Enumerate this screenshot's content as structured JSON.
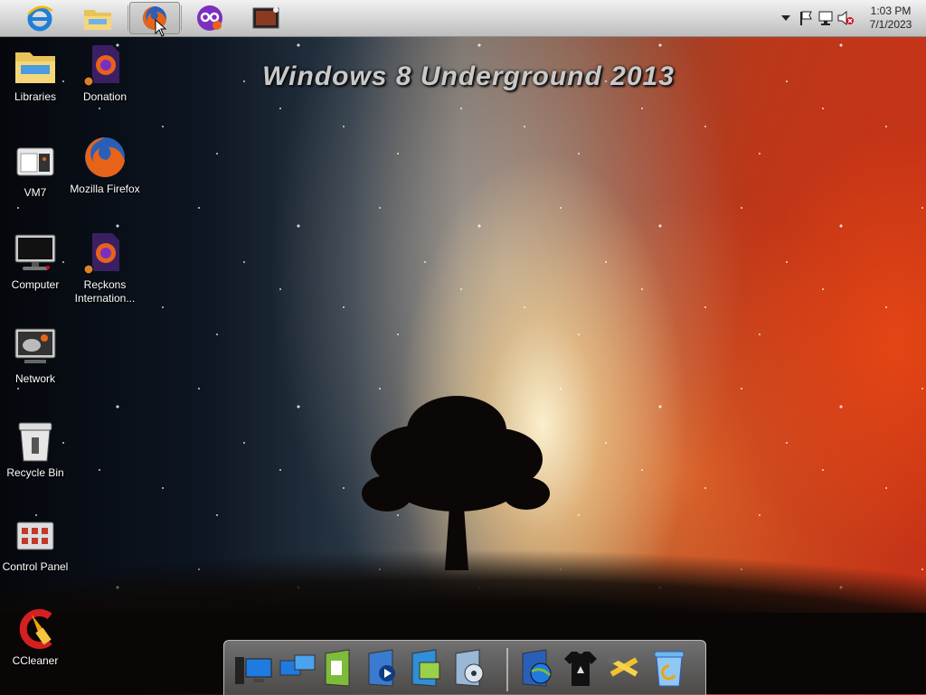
{
  "wallpaper": {
    "brand_text": "Windows 8 Underground 2013"
  },
  "taskbar": {
    "pinned": [
      {
        "name": "internet-explorer",
        "icon": "ie-icon"
      },
      {
        "name": "file-explorer",
        "icon": "folder-icon"
      },
      {
        "name": "firefox",
        "icon": "firefox-icon",
        "active": true
      },
      {
        "name": "purple-app",
        "icon": "purple-app-icon"
      },
      {
        "name": "media-player",
        "icon": "media-icon"
      }
    ],
    "tray": {
      "icons": [
        "arrow-up-icon",
        "flag-icon",
        "network-icon",
        "volume-muted-icon"
      ],
      "time": "1:03 PM",
      "date": "7/1/2023"
    }
  },
  "desktop": {
    "icons": [
      {
        "label": "Libraries",
        "icon": "libraries-icon"
      },
      {
        "label": "Donation",
        "icon": "firefox-doc-icon"
      },
      {
        "label": "VM7",
        "icon": "vm-icon"
      },
      {
        "label": "Mozilla Firefox",
        "icon": "firefox-icon"
      },
      {
        "label": "Computer",
        "icon": "computer-icon"
      },
      {
        "label": "Reckons Internation...",
        "icon": "firefox-doc-icon"
      },
      {
        "label": "Network",
        "icon": "network-icon"
      },
      {
        "label": "Recycle Bin",
        "icon": "recycle-bin-icon"
      },
      {
        "label": "Control Panel",
        "icon": "control-panel-icon"
      },
      {
        "label": "CCleaner",
        "icon": "ccleaner-icon"
      }
    ]
  },
  "dock": {
    "items": [
      "computer-icon",
      "network-icon",
      "documents-icon",
      "music-icon",
      "pictures-icon",
      "disc-icon",
      "globe-icon",
      "shirt-icon",
      "tools-icon",
      "recycle-bin-icon"
    ]
  },
  "colors": {
    "taskbar": "#d2d2d2",
    "text": "#ffffff",
    "brand_text": "#c9c9c9"
  }
}
